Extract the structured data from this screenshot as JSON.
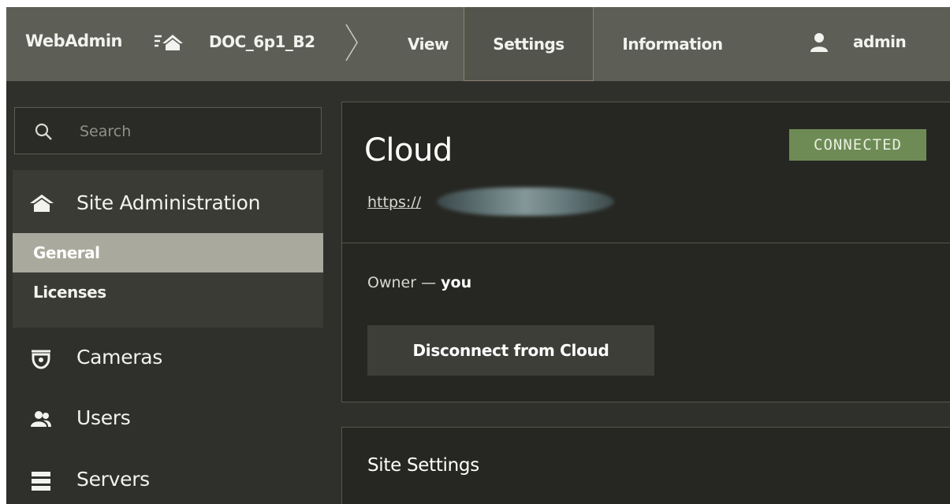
{
  "header": {
    "brand": "WebAdmin",
    "site_name": "DOC_6p1_B2",
    "tabs": [
      {
        "label": "View"
      },
      {
        "label": "Settings",
        "active": true
      },
      {
        "label": "Information"
      }
    ],
    "user": "admin"
  },
  "sidebar": {
    "search": {
      "placeholder": "Search",
      "value": ""
    },
    "sections": [
      {
        "label": "Site Administration",
        "icon": "home-icon",
        "items": [
          {
            "label": "General",
            "active": true
          },
          {
            "label": "Licenses"
          }
        ]
      },
      {
        "label": "Cameras",
        "icon": "camera-icon"
      },
      {
        "label": "Users",
        "icon": "users-icon"
      },
      {
        "label": "Servers",
        "icon": "servers-icon"
      }
    ]
  },
  "main": {
    "cloud": {
      "title": "Cloud",
      "status": "CONNECTED",
      "link_prefix": "https://",
      "owner_label": "Owner —",
      "owner_value": "you",
      "disconnect_label": "Disconnect from  Cloud"
    },
    "site_settings": {
      "title": "Site Settings"
    }
  },
  "colors": {
    "topbar": "#5d5f56",
    "background": "#2f302b",
    "panel": "#262722",
    "active_item": "#a9a99d",
    "status_connected": "#6f8b55"
  }
}
